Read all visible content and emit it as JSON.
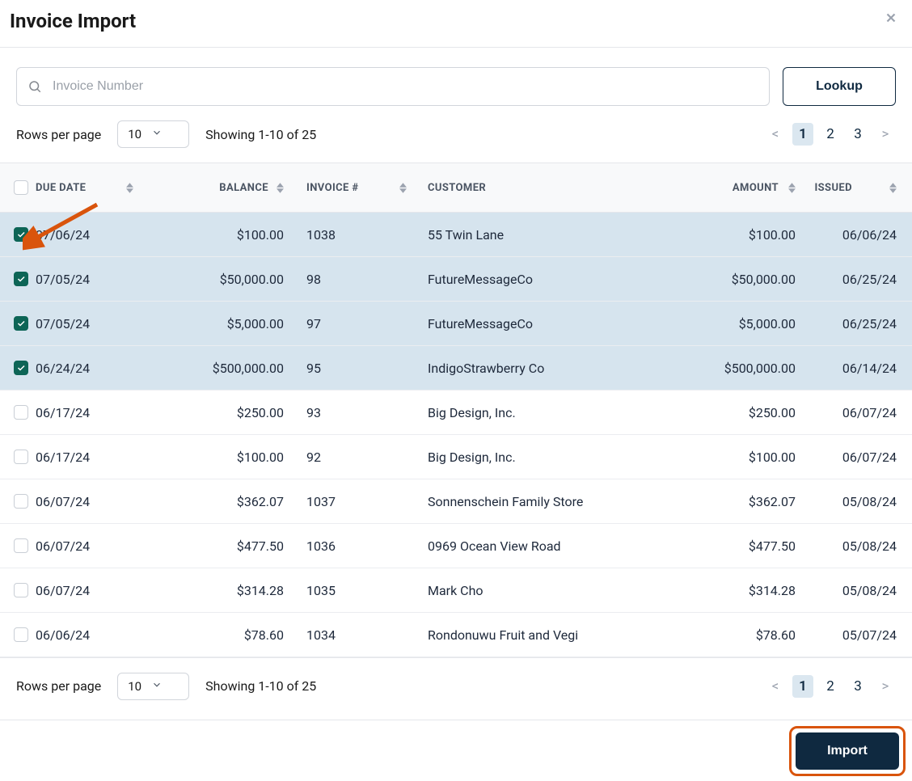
{
  "header": {
    "title": "Invoice Import"
  },
  "search": {
    "placeholder": "Invoice Number",
    "lookup_label": "Lookup"
  },
  "pager": {
    "rows_per_page_label": "Rows per page",
    "rows_per_page_value": "10",
    "showing_text": "Showing 1-10 of 25",
    "pages": [
      "1",
      "2",
      "3"
    ],
    "active_page": "1"
  },
  "table": {
    "columns": {
      "due_date": "DUE DATE",
      "balance": "BALANCE",
      "invoice": "INVOICE #",
      "customer": "CUSTOMER",
      "amount": "AMOUNT",
      "issued": "ISSUED"
    },
    "rows": [
      {
        "checked": true,
        "due_date": "07/06/24",
        "balance": "$100.00",
        "invoice": "1038",
        "customer": "55 Twin Lane",
        "amount": "$100.00",
        "issued": "06/06/24"
      },
      {
        "checked": true,
        "due_date": "07/05/24",
        "balance": "$50,000.00",
        "invoice": "98",
        "customer": "FutureMessageCo",
        "amount": "$50,000.00",
        "issued": "06/25/24"
      },
      {
        "checked": true,
        "due_date": "07/05/24",
        "balance": "$5,000.00",
        "invoice": "97",
        "customer": "FutureMessageCo",
        "amount": "$5,000.00",
        "issued": "06/25/24"
      },
      {
        "checked": true,
        "due_date": "06/24/24",
        "balance": "$500,000.00",
        "invoice": "95",
        "customer": "IndigoStrawberry Co",
        "amount": "$500,000.00",
        "issued": "06/14/24"
      },
      {
        "checked": false,
        "due_date": "06/17/24",
        "balance": "$250.00",
        "invoice": "93",
        "customer": "Big Design, Inc.",
        "amount": "$250.00",
        "issued": "06/07/24"
      },
      {
        "checked": false,
        "due_date": "06/17/24",
        "balance": "$100.00",
        "invoice": "92",
        "customer": "Big Design, Inc.",
        "amount": "$100.00",
        "issued": "06/07/24"
      },
      {
        "checked": false,
        "due_date": "06/07/24",
        "balance": "$362.07",
        "invoice": "1037",
        "customer": "Sonnenschein Family Store",
        "amount": "$362.07",
        "issued": "05/08/24"
      },
      {
        "checked": false,
        "due_date": "06/07/24",
        "balance": "$477.50",
        "invoice": "1036",
        "customer": "0969 Ocean View Road",
        "amount": "$477.50",
        "issued": "05/08/24"
      },
      {
        "checked": false,
        "due_date": "06/07/24",
        "balance": "$314.28",
        "invoice": "1035",
        "customer": "Mark Cho",
        "amount": "$314.28",
        "issued": "05/08/24"
      },
      {
        "checked": false,
        "due_date": "06/06/24",
        "balance": "$78.60",
        "invoice": "1034",
        "customer": "Rondonuwu Fruit and Vegi",
        "amount": "$78.60",
        "issued": "05/07/24"
      }
    ]
  },
  "footer": {
    "import_label": "Import"
  }
}
